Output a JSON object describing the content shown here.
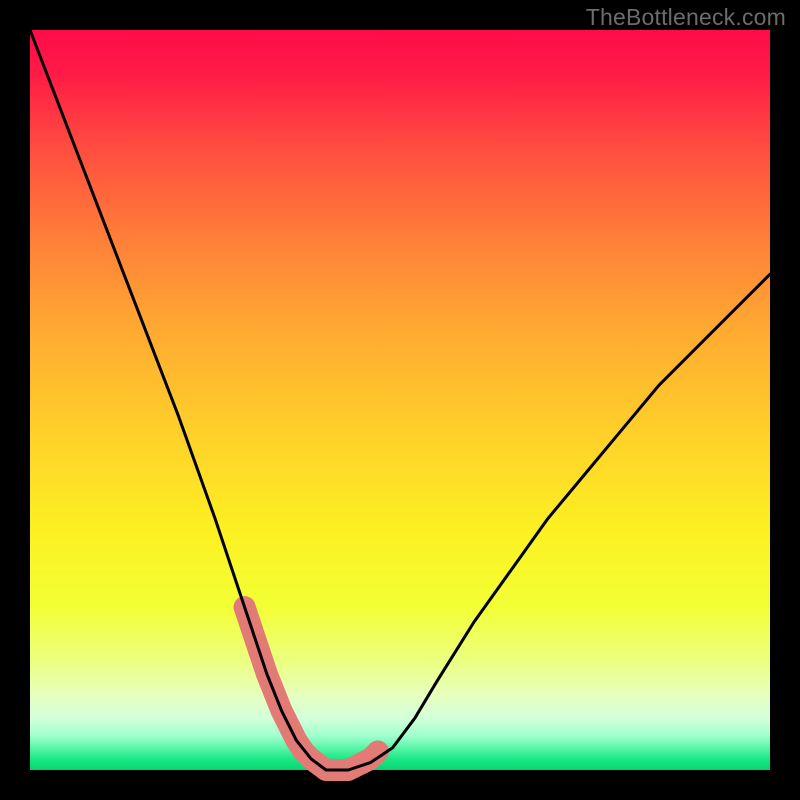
{
  "watermark": "TheBottleneck.com",
  "chart_data": {
    "type": "line",
    "title": "",
    "xlabel": "",
    "ylabel": "",
    "xlim": [
      0,
      100
    ],
    "ylim": [
      0,
      100
    ],
    "series": [
      {
        "name": "bottleneck-curve",
        "x": [
          0,
          5,
          10,
          15,
          20,
          25,
          28,
          30,
          32,
          34,
          36,
          38,
          40,
          43,
          46,
          49,
          52,
          55,
          60,
          65,
          70,
          75,
          80,
          85,
          90,
          95,
          100
        ],
        "values": [
          100,
          87,
          74,
          61,
          48,
          34,
          25,
          19,
          13,
          8,
          4,
          1.5,
          0,
          0,
          1,
          3,
          7,
          12,
          20,
          27,
          34,
          40,
          46,
          52,
          57,
          62,
          67
        ]
      },
      {
        "name": "highlight-band",
        "x": [
          29,
          30,
          31,
          32,
          34,
          36,
          37,
          38,
          40,
          41,
          43,
          44,
          45,
          46,
          47
        ],
        "values": [
          22,
          19,
          16,
          13,
          8,
          4,
          2.5,
          1.5,
          0,
          0,
          0,
          0.5,
          1,
          1.5,
          2.5
        ]
      }
    ],
    "colors": {
      "curve": "#000000",
      "highlight": "#e27a76",
      "gradient_top": "#ff0b49",
      "gradient_bottom": "#05d572"
    }
  }
}
